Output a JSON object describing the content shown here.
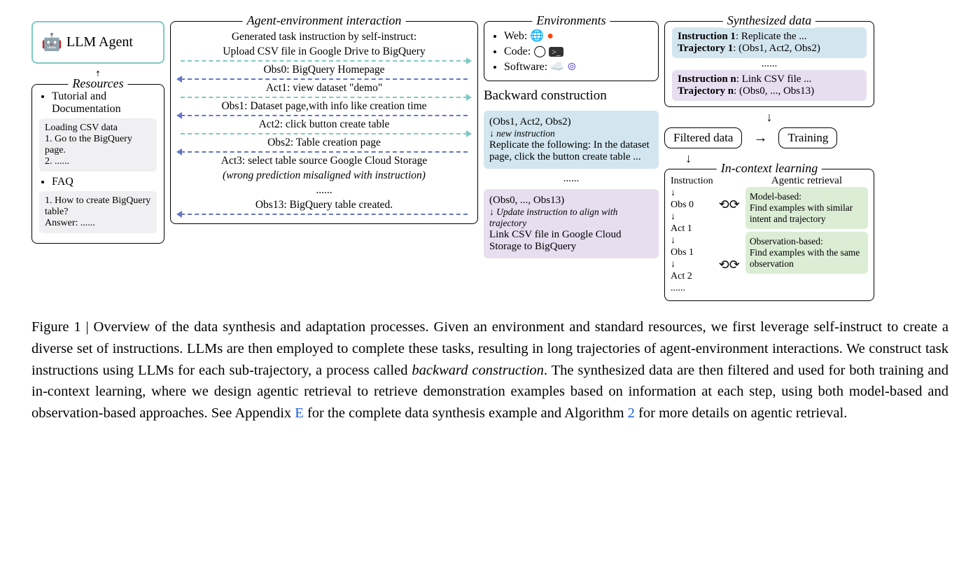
{
  "llm_agent": {
    "label": "LLM Agent"
  },
  "resources": {
    "title": "Resources",
    "item1": "Tutorial and Documentation",
    "sub1_title": "Loading CSV data",
    "sub1_step1": "1. Go to the BigQuery page.",
    "sub1_step2": "2. ......",
    "item2": "FAQ",
    "sub2_q": "1. How to create BigQuery table?",
    "sub2_a": "Answer: ......"
  },
  "agent_env": {
    "title": "Agent-environment interaction",
    "gen1": "Generated task instruction by self-instruct:",
    "gen2": "Upload CSV file in Google Drive to BigQuery",
    "obs0": "Obs0: BigQuery Homepage",
    "act1": "Act1: view dataset \"demo\"",
    "obs1": "Obs1: Dataset page,with info like creation time",
    "act2": "Act2: click button create table",
    "obs2": "Obs2: Table creation page",
    "act3a": "Act3: select table source Google Cloud Storage",
    "act3b": "(wrong prediction misaligned with instruction)",
    "ellipsis": "......",
    "obs13": "Obs13: BigQuery table created."
  },
  "environments": {
    "title": "Environments",
    "web": "Web:",
    "code": "Code:",
    "software": "Software:"
  },
  "backward": {
    "title": "Backward construction",
    "card1_traj": "(Obs1, Act2, Obs2)",
    "card1_label": "new instruction",
    "card1_text": "Replicate the following: In the dataset page, click the button create table ...",
    "ellipsis": "......",
    "card2_traj": "(Obs0, ..., Obs13)",
    "card2_label": "Update  instruction to align with trajectory",
    "card2_text": "Link CSV file in Google Cloud Storage to BigQuery"
  },
  "synth": {
    "title": "Synthesized data",
    "i1_label": "Instruction 1",
    "i1_text": ": Replicate the ...",
    "t1_label": "Trajectory 1",
    "t1_text": ": (Obs1, Act2, Obs2)",
    "ellipsis": "......",
    "in_label": "Instruction n",
    "in_text": ": Link CSV file ...",
    "tn_label": "Trajectory n",
    "tn_text": ": (Obs0, ..., Obs13)"
  },
  "filtered": {
    "label": "Filtered data"
  },
  "training": {
    "label": "Training"
  },
  "icl": {
    "title": "In-context learning",
    "instruction": "Instruction",
    "obs0": "Obs 0",
    "act1": "Act 1",
    "obs1": "Obs 1",
    "act2": "Act 2",
    "ellipsis": "......",
    "retrieval_title": "Agentic retrieval",
    "model_based": "Model-based:",
    "model_text": "Find examples with similar intent and trajectory",
    "obs_based": "Observation-based:",
    "obs_text": "Find examples with the same observation"
  },
  "caption": {
    "fig_label": "Figure 1 | ",
    "text1": "Overview of the data synthesis and adaptation processes. Given an environment and standard resources, we first leverage self-instruct to create a diverse set of instructions. LLMs are then employed to complete these tasks, resulting in long trajectories of agent-environment interactions. We construct task instructions using LLMs for each sub-trajectory, a process called ",
    "bc_italic": "backward construction",
    "text2": ". The synthesized data are then filtered and used for both training and in-context learning, where we design agentic retrieval to retrieve demonstration examples based on information at each step, using both model-based and observation-based approaches. See Appendix ",
    "link_e": "E",
    "text3": " for the complete data synthesis example and Algorithm ",
    "link_2": "2",
    "text4": " for more details on agentic retrieval."
  }
}
